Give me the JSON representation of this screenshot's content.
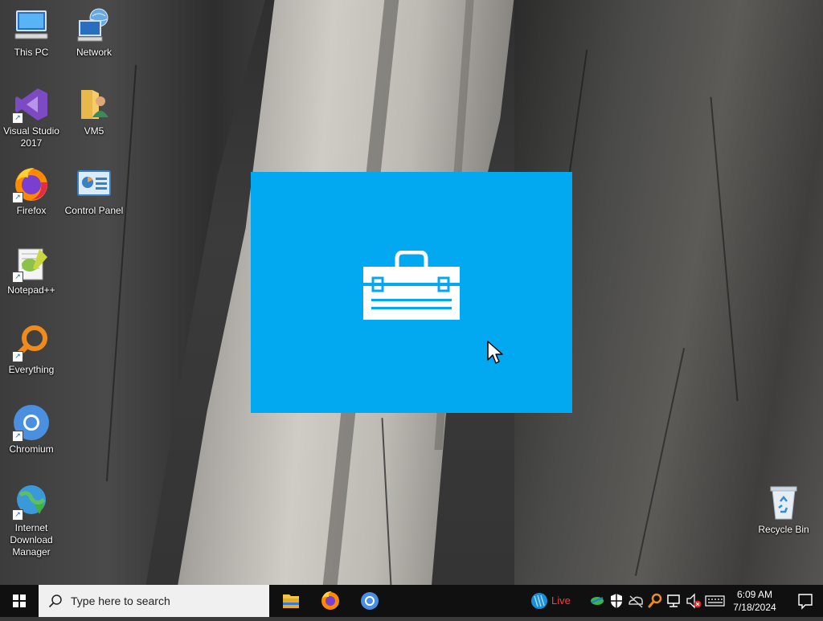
{
  "desktop": {
    "icons": [
      {
        "name": "This PC"
      },
      {
        "name": "Network"
      },
      {
        "name": "Visual Studio 2017"
      },
      {
        "name": "VM5"
      },
      {
        "name": "Firefox"
      },
      {
        "name": "Control Panel"
      },
      {
        "name": "Notepad++"
      },
      {
        "name": "Everything"
      },
      {
        "name": "Chromium"
      },
      {
        "name": "Internet Download Manager"
      },
      {
        "name": "Recycle Bin"
      }
    ]
  },
  "splash": {
    "icon": "toolbox-icon",
    "background": "#03a9f0"
  },
  "taskbar": {
    "search_placeholder": "Type here to search",
    "live_label": "Live",
    "clock_time": "6:09 AM",
    "clock_date": "7/18/2024",
    "pinned": [
      "file-explorer-icon",
      "firefox-icon",
      "chromium-icon"
    ],
    "tray_icons": [
      "network-location-icon",
      "security-shield-icon",
      "onedrive-icon",
      "search-tool-icon",
      "network-icon",
      "volume-muted-icon",
      "keyboard-icon"
    ]
  }
}
